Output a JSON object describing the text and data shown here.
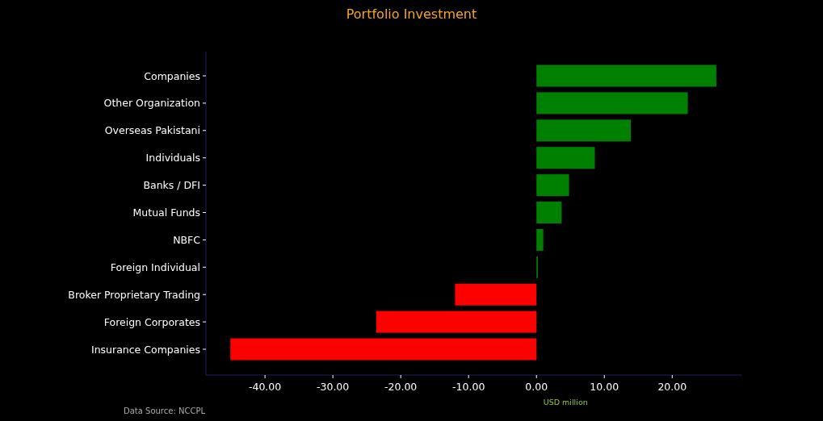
{
  "title": "Portfolio Investment",
  "chart": {
    "chart_data": {
      "type": "bar",
      "orientation": "horizontal",
      "xlabel": "USD million",
      "categories": [
        "Companies",
        "Other Organization",
        "Overseas Pakistani",
        "Individuals",
        "Banks / DFI",
        "Mutual Funds",
        "NBFC",
        "Foreign Individual",
        "Broker Proprietary Trading",
        "Foreign Corporates",
        "Insurance Companies"
      ],
      "values": [
        26.5,
        22.3,
        13.9,
        8.6,
        4.8,
        3.7,
        1.0,
        0.2,
        -12.0,
        -23.6,
        -45.1
      ],
      "xlim": [
        -48.7,
        30.2
      ],
      "xticks": [
        {
          "value": -40,
          "label": "-40.00"
        },
        {
          "value": -30,
          "label": "-30.00"
        },
        {
          "value": -20,
          "label": "-20.00"
        },
        {
          "value": -10,
          "label": "-10.00"
        },
        {
          "value": 0,
          "label": "0.00"
        },
        {
          "value": 10,
          "label": "10.00"
        },
        {
          "value": 20,
          "label": "20.00"
        }
      ]
    }
  },
  "source": "Data Source: NCCPL"
}
